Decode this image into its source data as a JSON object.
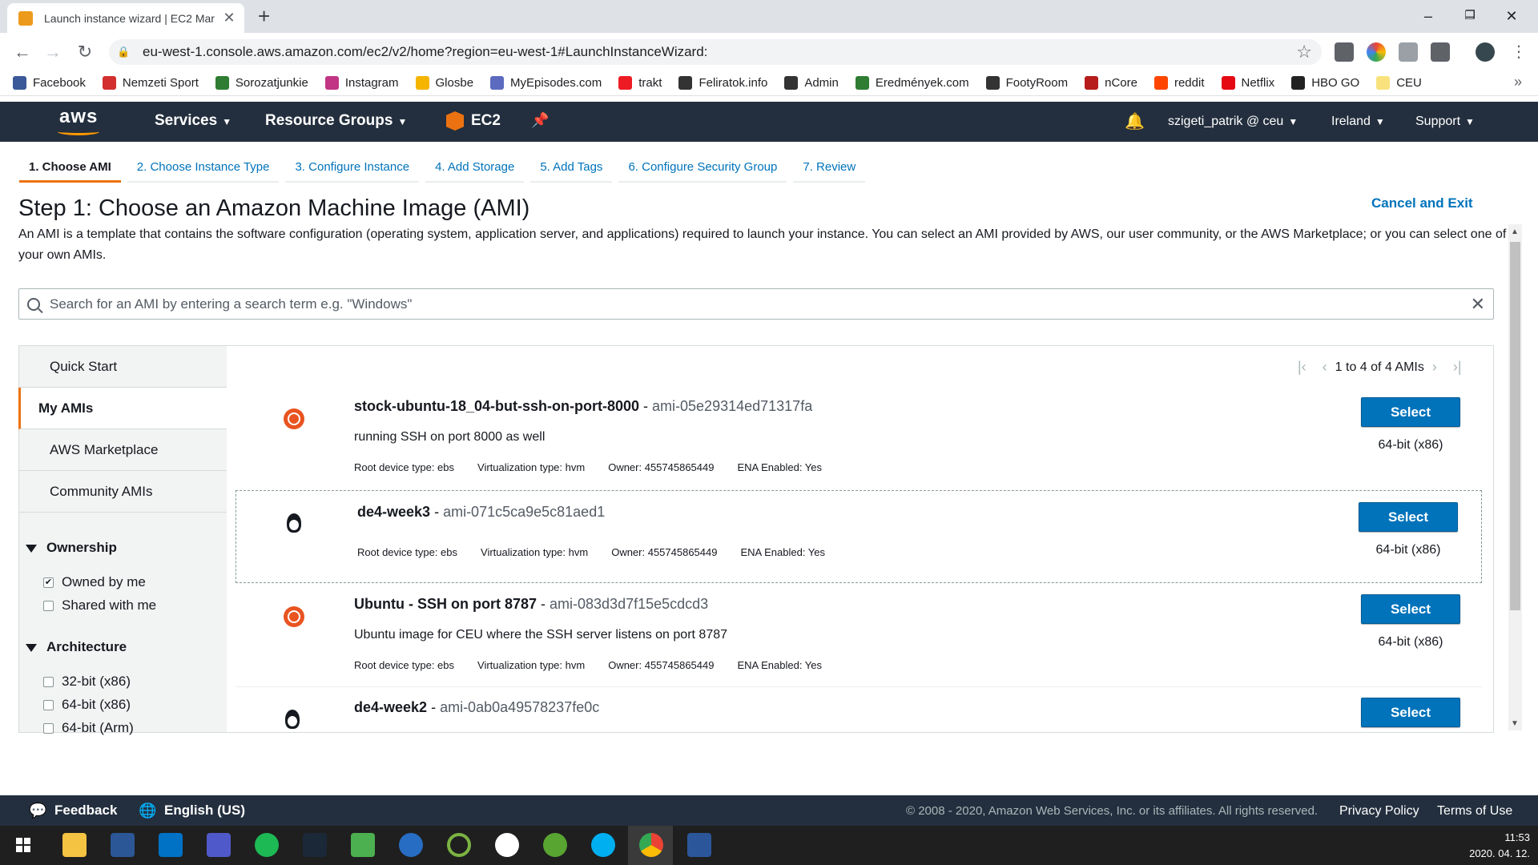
{
  "browser": {
    "tab_title": "Launch instance wizard | EC2 Mar",
    "url": "eu-west-1.console.aws.amazon.com/ec2/v2/home?region=eu-west-1#LaunchInstanceWizard:",
    "bookmarks": [
      {
        "label": "Facebook",
        "color": "#3b5998"
      },
      {
        "label": "Nemzeti Sport",
        "color": "#d32f2f"
      },
      {
        "label": "Sorozatjunkie",
        "color": "#2e7d32"
      },
      {
        "label": "Instagram",
        "color": "#c13584"
      },
      {
        "label": "Glosbe",
        "color": "#f4b400"
      },
      {
        "label": "MyEpisodes.com",
        "color": "#5c6bc0"
      },
      {
        "label": "trakt",
        "color": "#ed1c24"
      },
      {
        "label": "Feliratok.info",
        "color": "#333333"
      },
      {
        "label": "Admin",
        "color": "#333333"
      },
      {
        "label": "Eredmények.com",
        "color": "#2e7d32"
      },
      {
        "label": "FootyRoom",
        "color": "#333333"
      },
      {
        "label": "nCore",
        "color": "#b71c1c"
      },
      {
        "label": "reddit",
        "color": "#ff4500"
      },
      {
        "label": "Netflix",
        "color": "#e50914"
      },
      {
        "label": "HBO GO",
        "color": "#222222"
      },
      {
        "label": "CEU",
        "color": "#f9e27d"
      }
    ],
    "more": "»"
  },
  "aws_nav": {
    "logo": "aws",
    "services": "Services",
    "resource_groups": "Resource Groups",
    "ec2": "EC2",
    "user": "szigeti_patrik @ ceu",
    "region": "Ireland",
    "support": "Support"
  },
  "wizard": {
    "steps": [
      "1. Choose AMI",
      "2. Choose Instance Type",
      "3. Configure Instance",
      "4. Add Storage",
      "5. Add Tags",
      "6. Configure Security Group",
      "7. Review"
    ],
    "title": "Step 1: Choose an Amazon Machine Image (AMI)",
    "cancel": "Cancel and Exit",
    "intro": "An AMI is a template that contains the software configuration (operating system, application server, and applications) required to launch your instance. You can select an AMI provided by AWS, our user community, or the AWS Marketplace; or you can select one of your own AMIs.",
    "search_placeholder": "Search for an AMI by entering a search term e.g. \"Windows\""
  },
  "sidebar": {
    "tabs": [
      "Quick Start",
      "My AMIs",
      "AWS Marketplace",
      "Community AMIs"
    ],
    "ownership_title": "Ownership",
    "ownership": [
      {
        "label": "Owned by me",
        "checked": true
      },
      {
        "label": "Shared with me",
        "checked": false
      }
    ],
    "architecture_title": "Architecture",
    "architecture": [
      {
        "label": "32-bit (x86)",
        "checked": false
      },
      {
        "label": "64-bit (x86)",
        "checked": false
      },
      {
        "label": "64-bit (Arm)",
        "checked": false
      }
    ]
  },
  "pager": {
    "text": "1 to 4 of 4 AMIs"
  },
  "amis": [
    {
      "name": "stock-ubuntu-18_04-but-ssh-on-port-8000",
      "id": "ami-05e29314ed71317fa",
      "description": "running SSH on port 8000 as well",
      "root": "Root device type: ebs",
      "virt": "Virtualization type: hvm",
      "owner": "Owner: 455745865449",
      "ena": "ENA Enabled: Yes",
      "select": "Select",
      "arch": "64-bit (x86)",
      "os": "ubuntu-icon"
    },
    {
      "name": "de4-week3",
      "id": "ami-071c5ca9e5c81aed1",
      "description": "",
      "root": "Root device type: ebs",
      "virt": "Virtualization type: hvm",
      "owner": "Owner: 455745865449",
      "ena": "ENA Enabled: Yes",
      "select": "Select",
      "arch": "64-bit (x86)",
      "os": "linux-icon"
    },
    {
      "name": "Ubuntu - SSH on port 8787",
      "id": "ami-083d3d7f15e5cdcd3",
      "description": "Ubuntu image for CEU where the SSH server listens on port 8787",
      "root": "Root device type: ebs",
      "virt": "Virtualization type: hvm",
      "owner": "Owner: 455745865449",
      "ena": "ENA Enabled: Yes",
      "select": "Select",
      "arch": "64-bit (x86)",
      "os": "ubuntu-icon"
    },
    {
      "name": "de4-week2",
      "id": "ami-0ab0a49578237fe0c",
      "select": "Select",
      "os": "linux-icon"
    }
  ],
  "footer": {
    "feedback": "Feedback",
    "language": "English (US)",
    "copyright": "© 2008 - 2020, Amazon Web Services, Inc. or its affiliates. All rights reserved.",
    "privacy": "Privacy Policy",
    "terms": "Terms of Use"
  },
  "taskbar": {
    "time": "11:53",
    "date": "2020. 04. 12."
  },
  "colors": {
    "aws_nav_bg": "#232f3e",
    "aws_orange": "#ec7211",
    "link_blue": "#0073bb",
    "select_button": "#0073bb"
  }
}
